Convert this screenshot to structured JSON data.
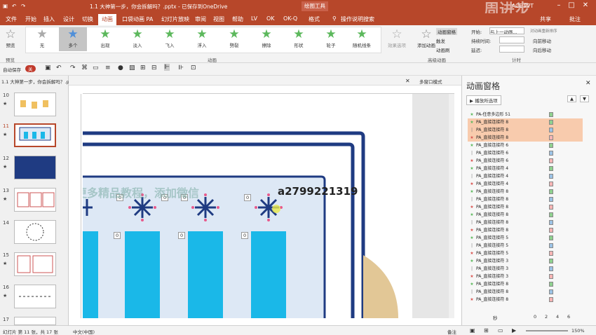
{
  "titlebar": {
    "doc_title": "1.1 大神第一步，你会拆解吗？.pptx - 已保存到OneDrive",
    "tool_context": "绘图工具",
    "user": "ACE PPT",
    "watermark": "周进步"
  },
  "tabs": [
    "文件",
    "开始",
    "插入",
    "设计",
    "切换",
    "动画",
    "口袋动画 PA",
    "幻灯片放映",
    "审阅",
    "视图",
    "帮助",
    "LV",
    "OK",
    "OK-Q",
    "格式",
    "操作说明搜索"
  ],
  "tab_actions": {
    "share": "共享",
    "comment": "批注"
  },
  "ribbon": {
    "preview_label": "预览",
    "preview_group": "预览",
    "effects": [
      "无",
      "多个",
      "出现",
      "淡入",
      "飞入",
      "浮入",
      "劈裂",
      "擦除",
      "形状",
      "轮子",
      "随机线条"
    ],
    "effect_options": "效果选项",
    "animation_group": "动画",
    "add_animation": "添加动画",
    "anim_pane_btn": "动画窗格",
    "trigger": "触发",
    "anim_brush": "动画刷",
    "advanced_group": "高级动画",
    "start_label": "开始:",
    "start_value": "与上一动画...",
    "duration_label": "持续时间:",
    "delay_label": "延迟:",
    "timing_group": "计时",
    "reorder_label": "对动画重新排序",
    "move_earlier": "向前移动",
    "move_later": "向后移动"
  },
  "qat": {
    "autosave_label": "自动保存",
    "autosave_state": "关"
  },
  "doc_tab": "1.1 大神第一步，你会拆解吗？.pptx",
  "view_mode": "多窗口模式",
  "slides": [
    "10",
    "11",
    "12",
    "13",
    "14",
    "15",
    "16",
    "17"
  ],
  "animpane": {
    "title": "动画窗格",
    "play_button": "播放所选项",
    "items": [
      {
        "name": "PA-任意多边形 51",
        "icon": "green",
        "sel": false
      },
      {
        "name": "PA_直接连接符 8",
        "icon": "green",
        "sel": true
      },
      {
        "name": "PA_直接连接符 8",
        "icon": "none",
        "sel": true
      },
      {
        "name": "PA_直接连接符 8",
        "icon": "red",
        "sel": true
      },
      {
        "name": "PA_直接连接符 6",
        "icon": "green",
        "sel": false
      },
      {
        "name": "PA_直接连接符 6",
        "icon": "none",
        "sel": false
      },
      {
        "name": "PA_直接连接符 6",
        "icon": "red",
        "sel": false
      },
      {
        "name": "PA_直接连接符 4",
        "icon": "green",
        "sel": false
      },
      {
        "name": "PA_直接连接符 4",
        "icon": "none",
        "sel": false
      },
      {
        "name": "PA_直接连接符 4",
        "icon": "red",
        "sel": false
      },
      {
        "name": "PA_直接连接符 8",
        "icon": "green",
        "sel": false
      },
      {
        "name": "PA_直接连接符 8",
        "icon": "none",
        "sel": false
      },
      {
        "name": "PA_直接连接符 8",
        "icon": "red",
        "sel": false
      },
      {
        "name": "PA_直接连接符 8",
        "icon": "green",
        "sel": false
      },
      {
        "name": "PA_直接连接符 8",
        "icon": "none",
        "sel": false
      },
      {
        "name": "PA_直接连接符 8",
        "icon": "red",
        "sel": false
      },
      {
        "name": "PA_直接连接符 5",
        "icon": "green",
        "sel": false
      },
      {
        "name": "PA_直接连接符 5",
        "icon": "none",
        "sel": false
      },
      {
        "name": "PA_直接连接符 5",
        "icon": "red",
        "sel": false
      },
      {
        "name": "PA_直接连接符 3",
        "icon": "green",
        "sel": false
      },
      {
        "name": "PA_直接连接符 3",
        "icon": "none",
        "sel": false
      },
      {
        "name": "PA_直接连接符 3",
        "icon": "red",
        "sel": false
      },
      {
        "name": "PA_直接连接符 8",
        "icon": "green",
        "sel": false
      },
      {
        "name": "PA_直接连接符 8",
        "icon": "none",
        "sel": false
      },
      {
        "name": "PA_直接连接符 8",
        "icon": "red",
        "sel": false
      }
    ],
    "seconds_label": "秒",
    "timeline_ticks": [
      "0",
      "2",
      "4",
      "6"
    ]
  },
  "slide_overlay": {
    "watermark_text": "更多精品教程，添加微信",
    "wechat_id": "a2799221319",
    "num_labels": [
      "0",
      "0",
      "0",
      "0",
      "0",
      "0",
      "0"
    ]
  },
  "statusbar": {
    "slide_info": "幻灯片 第 11 张，共 17 张",
    "language": "中文(中国)",
    "notes": "备注",
    "zoom": "150%"
  },
  "colors": {
    "accent": "#b7472a",
    "navy": "#1f3b82",
    "cyan": "#1ab8e8",
    "tan": "#e2c796"
  }
}
